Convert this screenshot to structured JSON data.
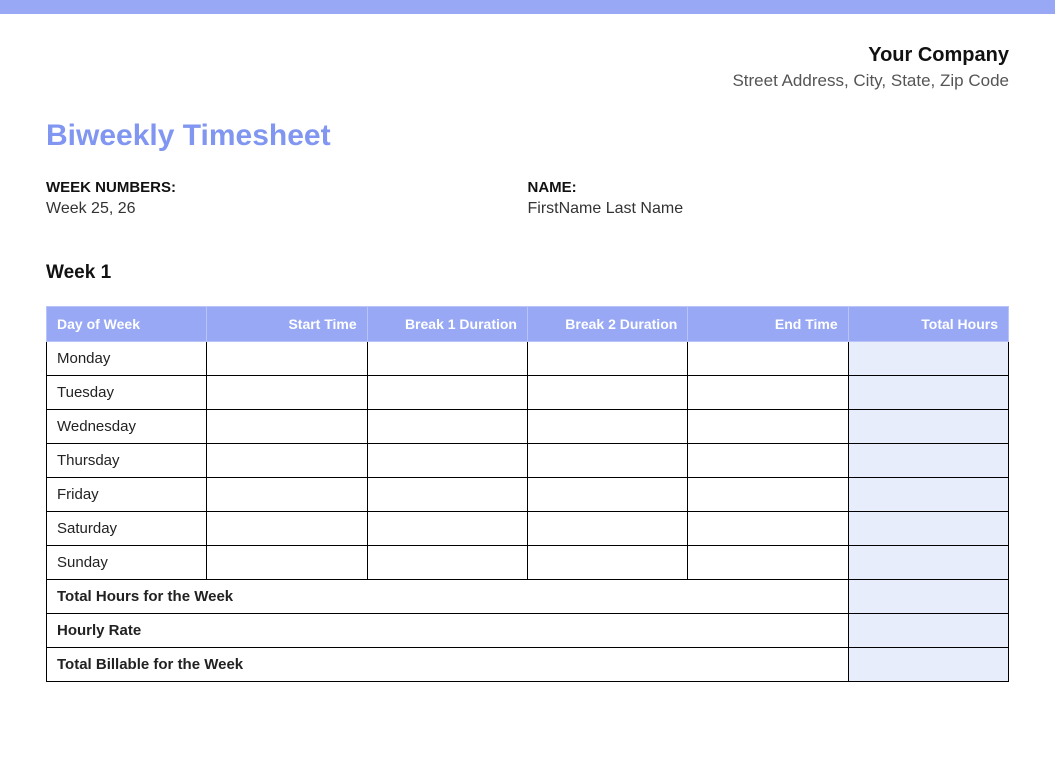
{
  "company": {
    "name": "Your Company",
    "address": "Street Address, City, State, Zip Code"
  },
  "title": "Biweekly Timesheet",
  "info": {
    "week_numbers_label": "WEEK NUMBERS:",
    "week_numbers_value": "Week 25, 26",
    "name_label": "NAME:",
    "name_value": "FirstName Last Name"
  },
  "week1": {
    "heading": "Week 1",
    "columns": {
      "day": "Day of Week",
      "start": "Start Time",
      "break1": "Break 1 Duration",
      "break2": "Break 2 Duration",
      "end": "End Time",
      "total": "Total Hours"
    },
    "days": {
      "mon": "Monday",
      "tue": "Tuesday",
      "wed": "Wednesday",
      "thu": "Thursday",
      "fri": "Friday",
      "sat": "Saturday",
      "sun": "Sunday"
    },
    "footer": {
      "total_hours": "Total Hours for the Week",
      "hourly_rate": "Hourly Rate",
      "total_billable": "Total Billable for the Week"
    }
  }
}
